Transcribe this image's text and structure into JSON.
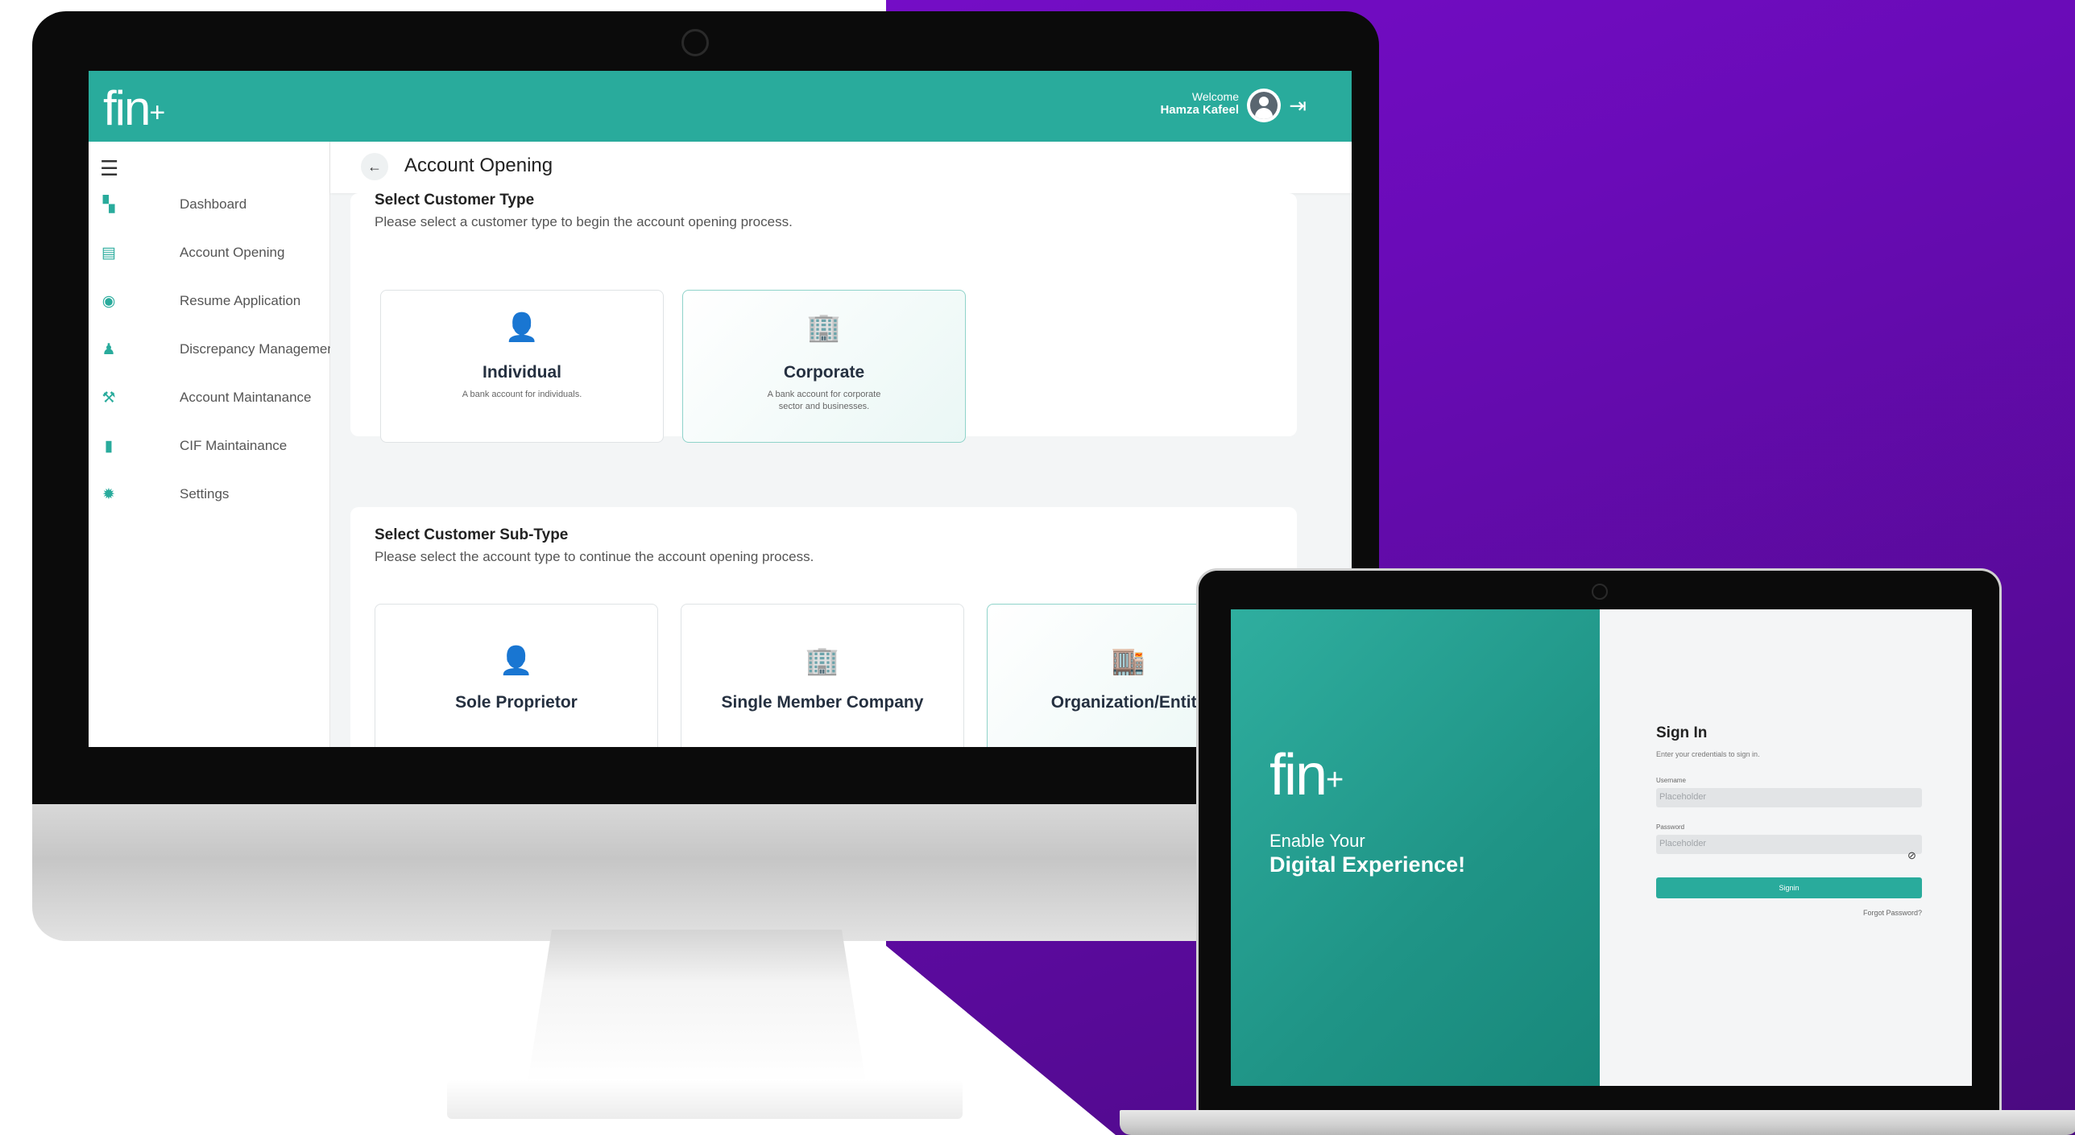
{
  "desktop_app": {
    "logo": {
      "text": "fin",
      "plus": "+"
    },
    "header": {
      "welcome": "Welcome",
      "user_name": "Hamza Kafeel"
    },
    "sidebar": {
      "items": [
        {
          "label": "Dashboard",
          "icon": "dashboard-icon"
        },
        {
          "label": "Account Opening",
          "icon": "account-opening-icon"
        },
        {
          "label": "Resume Application",
          "icon": "resume-icon"
        },
        {
          "label": "Discrepancy Management",
          "icon": "discrepancy-icon"
        },
        {
          "label": "Account Maintanance",
          "icon": "wrench-icon"
        },
        {
          "label": "CIF Maintainance",
          "icon": "document-icon"
        },
        {
          "label": "Settings",
          "icon": "gear-icon"
        }
      ]
    },
    "page_title": "Account Opening",
    "customer_type": {
      "title": "Select Customer Type",
      "subtitle": "Please select a customer type to begin the account opening process.",
      "options": [
        {
          "title": "Individual",
          "desc": "A bank account for individuals."
        },
        {
          "title": "Corporate",
          "desc": "A bank account for corporate sector and businesses."
        }
      ]
    },
    "customer_subtype": {
      "title": "Select Customer Sub-Type",
      "subtitle": "Please select the account type to continue the account opening process.",
      "options": [
        {
          "title": "Sole Proprietor"
        },
        {
          "title": "Single Member Company"
        },
        {
          "title": "Organization/Entity"
        }
      ]
    }
  },
  "login": {
    "logo": {
      "text": "fin",
      "plus": "+"
    },
    "tagline_1": "Enable Your",
    "tagline_2": "Digital Experience!",
    "title": "Sign In",
    "subtitle": "Enter your credentials to sign in.",
    "username_label": "Username",
    "username_placeholder": "Placeholder",
    "password_label": "Password",
    "password_placeholder": "Placeholder",
    "signin_button": "Signin",
    "forgot": "Forgot Password?"
  },
  "colors": {
    "primary": "#29ab9c",
    "purple": "#6a0bb8"
  }
}
